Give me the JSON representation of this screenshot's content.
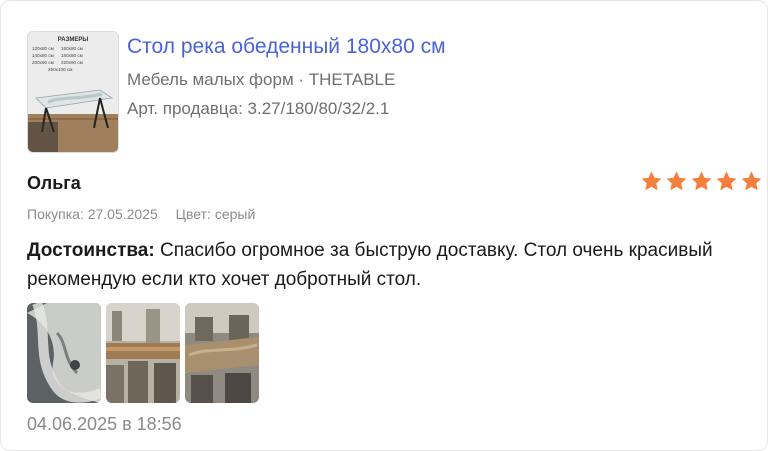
{
  "product": {
    "image_text": {
      "header": "РАЗМЕРЫ",
      "sizes": [
        "120x80 см",
        "160x80 см",
        "140x80 см",
        "180x80 см",
        "200x90 см",
        "220x90 см",
        "250x100 см"
      ]
    },
    "title": "Стол река обеденный 180x80 см",
    "meta": "Мебель малых форм · THETABLE",
    "article": "Арт. продавца: 3.27/180/80/32/2.1"
  },
  "review": {
    "author": "Ольга",
    "rating": 5,
    "rating_max": 5,
    "star_color": "#f5803e",
    "purchase_date": "Покупка: 27.05.2025",
    "color": "Цвет: серый",
    "pros_label": "Достоинства:",
    "pros_text": " Спасибо огромное за быструю доставку. Стол очень красивый рекомендую если кто хочет добротный стол.",
    "photos_count": 3,
    "posted_at": "04.06.2025 в 18:56"
  },
  "colors": {
    "link": "#4a63d8",
    "muted": "#8c8c8c"
  }
}
